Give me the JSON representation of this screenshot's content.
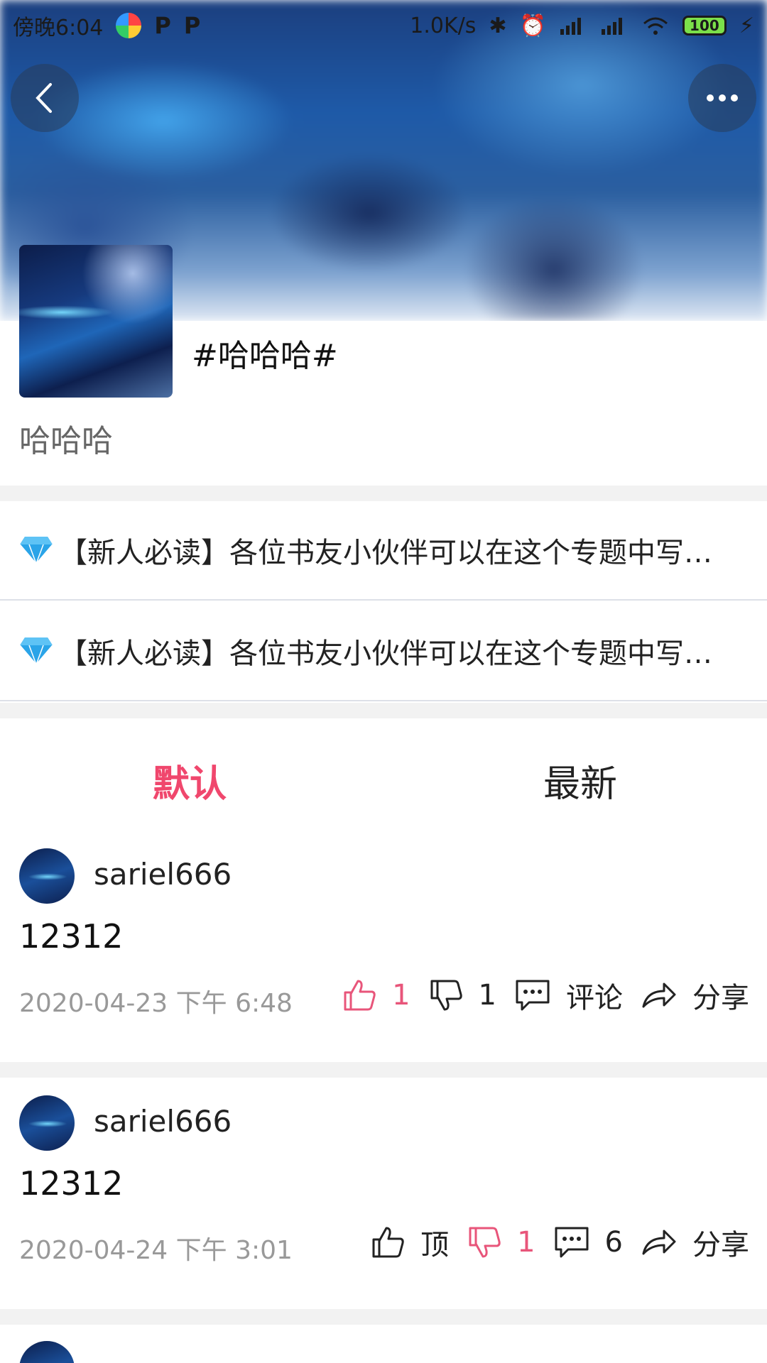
{
  "status_bar": {
    "time": "傍晚6:04",
    "network_speed": "1.0K/s",
    "battery": "100"
  },
  "topic": {
    "title": "#哈哈哈#",
    "description": "哈哈哈"
  },
  "notices": [
    {
      "text": "【新人必读】各位书友小伙伴可以在这个专题中写…"
    },
    {
      "text": "【新人必读】各位书友小伙伴可以在这个专题中写…"
    }
  ],
  "tabs": [
    {
      "label": "默认",
      "active": true
    },
    {
      "label": "最新",
      "active": false
    }
  ],
  "posts": [
    {
      "username": "sariel666",
      "content": "12312",
      "time": "2020-04-23 下午 6:48",
      "like_label": "1",
      "dislike_label": "1",
      "comment_label": "评论",
      "share_label": "分享",
      "liked": true,
      "disliked": false
    },
    {
      "username": "sariel666",
      "content": "12312",
      "time": "2020-04-24 下午 3:01",
      "like_label": "顶",
      "dislike_label": "1",
      "comment_label": "6",
      "share_label": "分享",
      "liked": false,
      "disliked": true
    }
  ],
  "colors": {
    "accent": "#f0476d",
    "active_action": "#e8557a",
    "muted": "#999999",
    "divider": "#f2f2f2"
  }
}
